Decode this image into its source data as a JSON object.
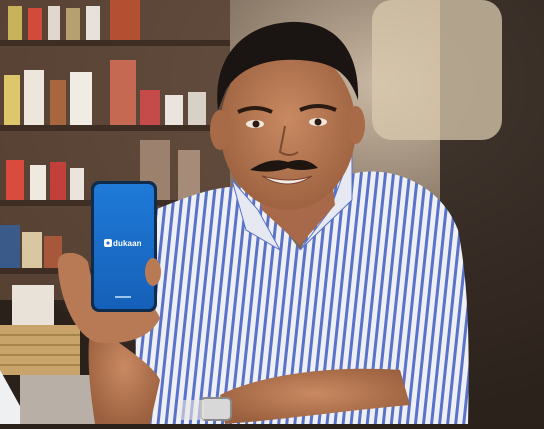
{
  "photo": {
    "phone_app": {
      "brand": "dukaan"
    }
  },
  "palette": {
    "phone_blue": "#1e73d2",
    "shirt_stripe_blue": "#5a72c8",
    "shirt_white": "#eef0f6",
    "shelf_wood": "#6b4a32"
  }
}
